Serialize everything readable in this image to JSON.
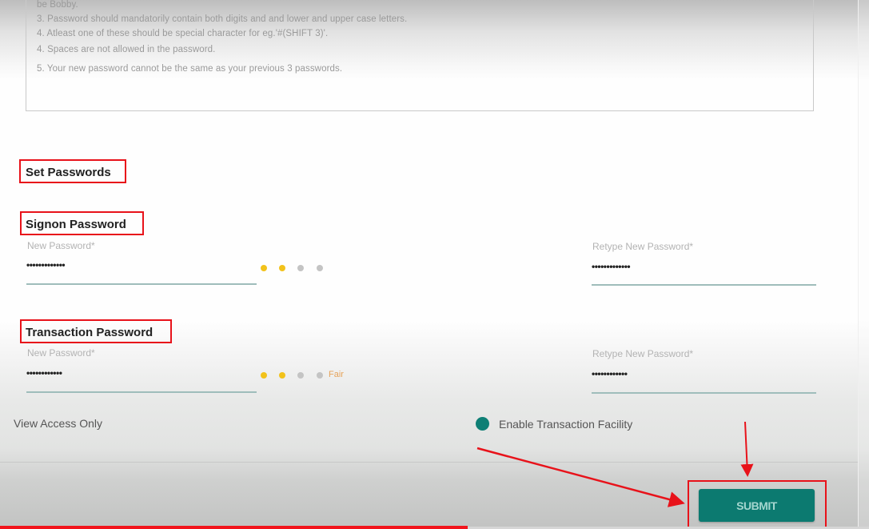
{
  "password_rules": [
    "be Bobby.",
    "3. Password should mandatorily contain both digits and and lower and upper case letters.",
    "4. Atleast one of these should be special character for eg.'#(SHIFT 3)'.",
    "4. Spaces are not allowed in the password.",
    "5. Your new password cannot be the same as your previous 3 passwords."
  ],
  "set_passwords_heading": "Set Passwords",
  "signon": {
    "heading": "Signon Password",
    "new_label": "New Password*",
    "new_value": "•••••••••••••",
    "retype_label": "Retype New Password*",
    "retype_value": "•••••••••••••",
    "strength": {
      "filled": 2,
      "total": 4,
      "text": ""
    }
  },
  "transaction": {
    "heading": "Transaction Password",
    "new_label": "New Password*",
    "new_value": "••••••••••••",
    "retype_label": "Retype New Password*",
    "retype_value": "••••••••••••",
    "strength": {
      "filled": 2,
      "total": 4,
      "text": "Fair"
    }
  },
  "access_options": [
    {
      "label": "View Access Only",
      "selected": false
    },
    {
      "label": "Enable Transaction Facility",
      "selected": true
    }
  ],
  "submit_label": "SUBMIT",
  "colors": {
    "accent": "#0c7a70",
    "strength_filled": "#f2c21b",
    "strength_empty": "#c4c4c4",
    "annotation_red": "#e8121a"
  }
}
